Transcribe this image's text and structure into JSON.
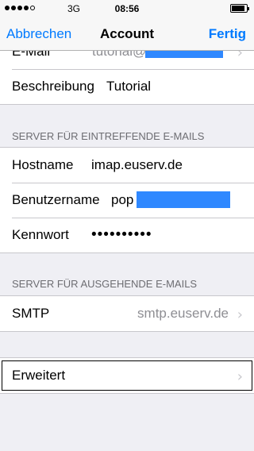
{
  "status_bar": {
    "network": "3G",
    "time": "08:56",
    "signal_bars_filled": 4,
    "signal_bars_total": 5,
    "battery_level": 0.9
  },
  "nav": {
    "cancel": "Abbrechen",
    "title": "Account",
    "done": "Fertig"
  },
  "account": {
    "email_label": "E-Mail",
    "email_value": "tutorial@",
    "description_label": "Beschreibung",
    "description_value": "Tutorial"
  },
  "incoming": {
    "header": "SERVER FÜR EINTREFFENDE E-MAILS",
    "hostname_label": "Hostname",
    "hostname_value": "imap.euserv.de",
    "username_label": "Benutzername",
    "username_value": "pop",
    "password_label": "Kennwort",
    "password_value": "••••••••••"
  },
  "outgoing": {
    "header": "SERVER FÜR AUSGEHENDE E-MAILS",
    "smtp_label": "SMTP",
    "smtp_value": "smtp.euserv.de"
  },
  "advanced": {
    "label": "Erweitert"
  },
  "colors": {
    "accent": "#007aff",
    "redaction": "#2f88ff",
    "background": "#efeff4"
  },
  "icons": [
    "chevron-right-icon"
  ]
}
